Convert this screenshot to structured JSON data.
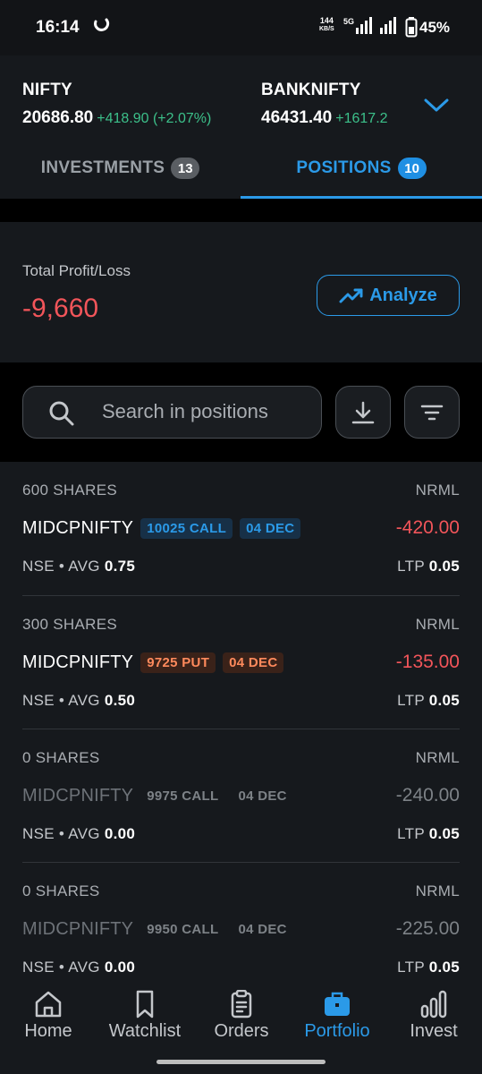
{
  "status_bar": {
    "time": "16:14",
    "net_speed_value": "144",
    "net_speed_unit": "KB/S",
    "network_type": "5G",
    "battery_pct": "45%"
  },
  "indices": [
    {
      "name": "NIFTY",
      "value": "20686.80",
      "change": "+418.90 (+2.07%)"
    },
    {
      "name": "BANKNIFTY",
      "value": "46431.40",
      "change": "+1617.2"
    }
  ],
  "tabs": [
    {
      "label": "INVESTMENTS",
      "count": "13",
      "active": false
    },
    {
      "label": "POSITIONS",
      "count": "10",
      "active": true
    }
  ],
  "summary": {
    "label": "Total Profit/Loss",
    "value": "-9,660",
    "analyze_label": "Analyze"
  },
  "search": {
    "placeholder": "Search in positions",
    "value": ""
  },
  "positions": [
    {
      "qty": "600 SHARES",
      "product": "NRML",
      "symbol": "MIDCPNIFTY",
      "strike": "10025 CALL",
      "expiry": "04 DEC",
      "pnl": "-420.00",
      "exchange": "NSE",
      "avg_label": "AVG",
      "avg": "0.75",
      "ltp_label": "LTP",
      "ltp": "0.05"
    },
    {
      "qty": "300 SHARES",
      "product": "NRML",
      "symbol": "MIDCPNIFTY",
      "strike": "9725 PUT",
      "expiry": "04 DEC",
      "pnl": "-135.00",
      "exchange": "NSE",
      "avg_label": "AVG",
      "avg": "0.50",
      "ltp_label": "LTP",
      "ltp": "0.05"
    },
    {
      "qty": "0 SHARES",
      "product": "NRML",
      "symbol": "MIDCPNIFTY",
      "strike": "9975 CALL",
      "expiry": "04 DEC",
      "pnl": "-240.00",
      "exchange": "NSE",
      "avg_label": "AVG",
      "avg": "0.00",
      "ltp_label": "LTP",
      "ltp": "0.05"
    },
    {
      "qty": "0 SHARES",
      "product": "NRML",
      "symbol": "MIDCPNIFTY",
      "strike": "9950 CALL",
      "expiry": "04 DEC",
      "pnl": "-225.00",
      "exchange": "NSE",
      "avg_label": "AVG",
      "avg": "0.00",
      "ltp_label": "LTP",
      "ltp": "0.05"
    }
  ],
  "nav": [
    {
      "label": "Home",
      "icon": "home-icon"
    },
    {
      "label": "Watchlist",
      "icon": "bookmark-icon"
    },
    {
      "label": "Orders",
      "icon": "clipboard-icon"
    },
    {
      "label": "Portfolio",
      "icon": "briefcase-icon",
      "active": true
    },
    {
      "label": "Invest",
      "icon": "bar-chart-icon"
    }
  ],
  "colors": {
    "accent": "#2b9ae8",
    "loss": "#f2555a",
    "gain": "#3cc08a",
    "put_chip": "#ff8a5c",
    "background": "#16191d"
  }
}
